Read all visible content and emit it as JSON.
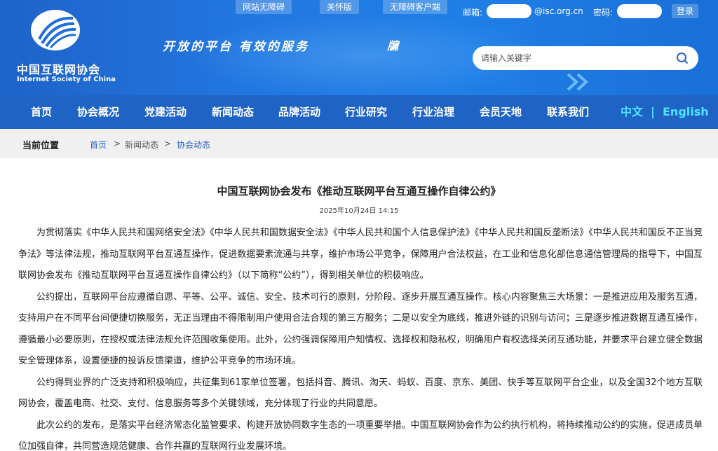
{
  "header": {
    "logo_cn": "中国互联网协会",
    "logo_en": "Internet Society of China",
    "slogan": "开放的平台  有效的服务",
    "slogan_mark": "牖",
    "top_buttons": [
      "网站无障碍",
      "关怀版",
      "无障碍客户端"
    ],
    "email_label": "邮箱:",
    "email_domain": "@isc.org.cn",
    "password_label": "密码:",
    "login_label": "登录",
    "search_placeholder": "请输入关键字"
  },
  "nav": {
    "items": [
      "首页",
      "协会概况",
      "党建活动",
      "新闻动态",
      "品牌活动",
      "行业研究",
      "行业治理",
      "会员天地",
      "联系我们"
    ],
    "lang_cn": "中文",
    "lang_sep": "|",
    "lang_en": "English"
  },
  "breadcrumb": {
    "title": "当前位置",
    "items": [
      "首页",
      "新闻动态",
      "协会动态"
    ],
    "separator": ">"
  },
  "article": {
    "title": "中国互联网协会发布《推动互联网平台互通互操作自律公约》",
    "date": "2025年10月24日 14:15",
    "paragraphs": [
      "为贯彻落实《中华人民共和国网络安全法》《中华人民共和国数据安全法》《中华人民共和国个人信息保护法》《中华人民共和国反垄断法》《中华人民共和国反不正当竞争法》等法律法规，推动互联网平台互通互操作，促进数据要素流通与共享，维护市场公平竞争，保障用户合法权益，在工业和信息化部信息通信管理局的指导下，中国互联网协会发布《推动互联网平台互通互操作自律公约》（以下简称“公约”），得到相关单位的积极响应。",
      "公约提出，互联网平台应遵循自愿、平等、公平、诚信、安全、技术可行的原则，分阶段、逐步开展互通互操作。核心内容聚焦三大场景：一是推进应用及服务互通，支持用户在不同平台间便捷切换服务，无正当理由不得限制用户使用合法合规的第三方服务；二是以安全为底线，推进外链的识别与访问；三是逐步推进数据互通互操作，遵循最小必要原则，在授权或法律法规允许范围收集使用。此外，公约强调保障用户知情权、选择权和隐私权，明确用户有权选择关闭互通功能，并要求平台建立健全数据安全管理体系，设置便捷的投诉反馈渠道，维护公平竞争的市场环境。",
      "公约得到业界的广泛支持和积极响应，共征集到61家单位签署，包括抖音、腾讯、淘天、蚂蚁、百度、京东、美团、快手等互联网平台企业，以及全国32个地方互联网协会，覆盖电商、社交、支付、信息服务等多个关键领域，充分体现了行业的共同意愿。",
      "此次公约的发布，是落实平台经济常态化监管要求、构建开放协同数字生态的一项重要举措。中国互联网协会作为公约执行机构，将持续推动公约的实施，促进成员单位加强自律，共同营造规范健康、合作共赢的互联网行业发展环境。"
    ]
  },
  "colors": {
    "header_blue": "#1f74dc",
    "nav_blue": "#1f64c4",
    "lang_cyan": "#4fe3ff",
    "link_blue": "#2a63c8"
  }
}
